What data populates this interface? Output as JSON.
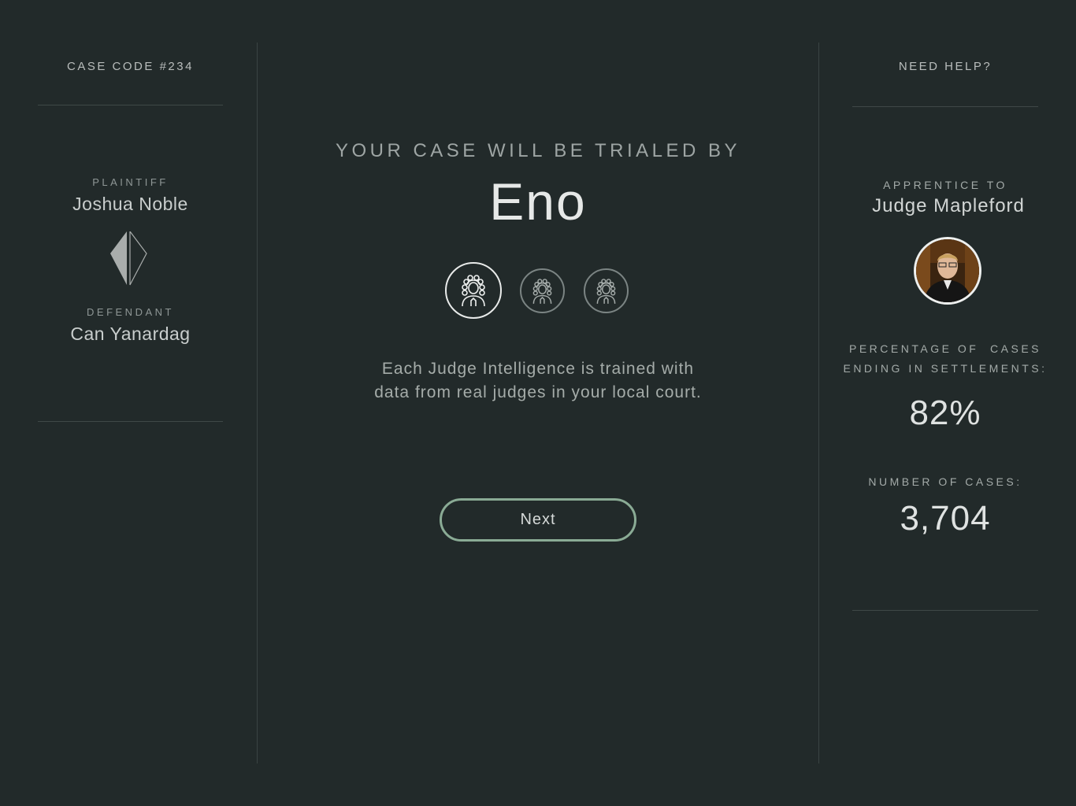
{
  "left_panel": {
    "case_code": "CASE CODE #234",
    "plaintiff_label": "PLAINTIFF",
    "plaintiff_name": "Joshua Noble",
    "defendant_label": "DEFENDANT",
    "defendant_name": "Can Yanardag",
    "divider_icon": "crystal-icon"
  },
  "center": {
    "title": "YOUR CASE WILL BE TRIALED BY",
    "judge_name": "Eno",
    "judge_options": [
      {
        "icon": "judge-wig-icon",
        "selected": true
      },
      {
        "icon": "judge-wig-icon",
        "selected": false
      },
      {
        "icon": "judge-wig-icon",
        "selected": false
      }
    ],
    "description_line1": "Each Judge Intelligence is trained with",
    "description_line2": "data from real judges in your local court.",
    "next_label": "Next"
  },
  "right_panel": {
    "help_label": "NEED HELP?",
    "apprentice_label": "APPRENTICE TO",
    "mentor_name": "Judge Mapleford",
    "avatar_icon": "judge-portrait",
    "settlement_label_line1": "PERCENTAGE OF  CASES",
    "settlement_label_line2": "ENDING IN SETTLEMENTS:",
    "settlement_value": "82%",
    "cases_label": "NUMBER OF CASES:",
    "cases_value": "3,704"
  },
  "colors": {
    "background": "#222a2a",
    "accent_button_border": "#8aab95",
    "divider": "#3a4443"
  }
}
